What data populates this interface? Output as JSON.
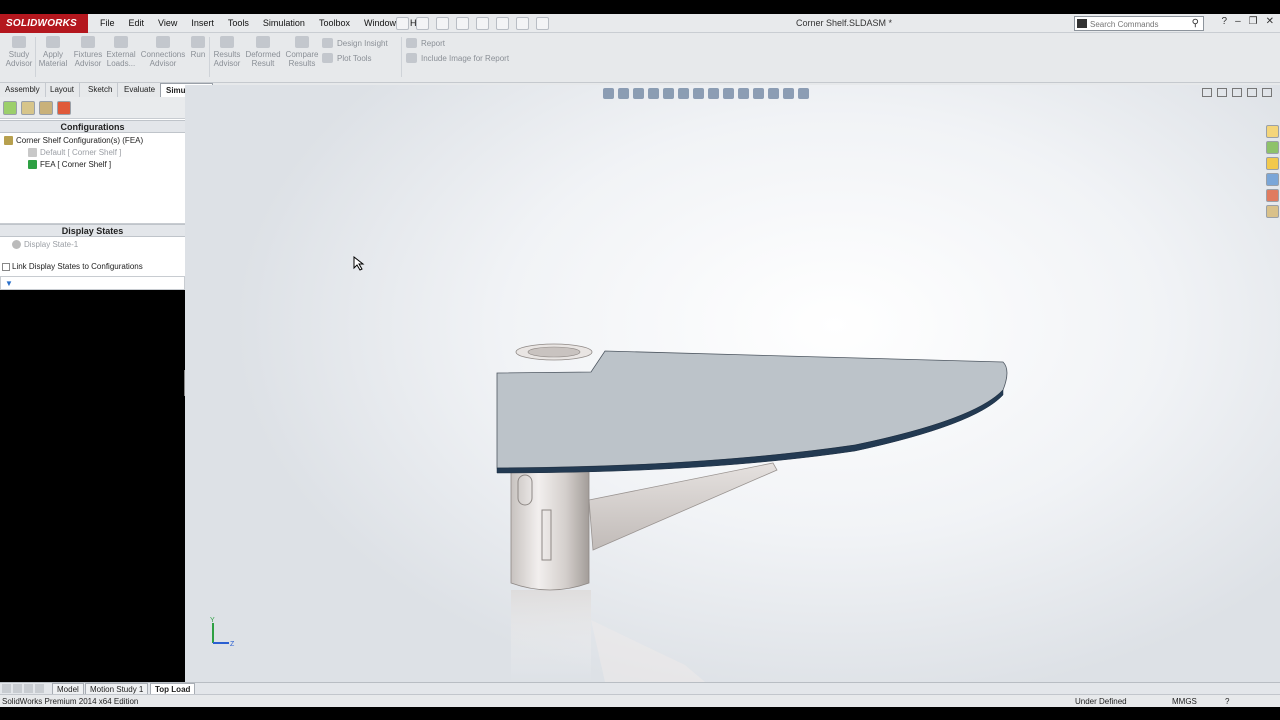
{
  "app": {
    "logo_text": "SOLIDWORKS",
    "document_title": "Corner Shelf.SLDASM *"
  },
  "menu": [
    "File",
    "Edit",
    "View",
    "Insert",
    "Tools",
    "Simulation",
    "Toolbox",
    "Window",
    "Help"
  ],
  "search": {
    "placeholder": "Search Commands"
  },
  "command_manager": {
    "study_advisor": "Study Advisor",
    "apply_material": "Apply Material",
    "fixtures_advisor": "Fixtures Advisor",
    "external_loads": "External Loads...",
    "connections_advisor": "Connections Advisor",
    "run": "Run",
    "results_advisor": "Results Advisor",
    "deformed_result": "Deformed Result",
    "compare_results": "Compare Results",
    "design_insight": "Design Insight",
    "plot_tools": "Plot Tools",
    "report": "Report",
    "include_image": "Include Image for Report"
  },
  "tabs": [
    "Assembly",
    "Layout",
    "Sketch",
    "Evaluate",
    "Simulation"
  ],
  "active_tab": "Simulation",
  "config_panel": {
    "title": "Configurations",
    "root": "Corner Shelf Configuration(s)  (FEA)",
    "items": [
      "Default [ Corner Shelf ]",
      "FEA [ Corner Shelf ]"
    ]
  },
  "display_states": {
    "title": "Display States",
    "item": "Display State-1",
    "link_checkbox": "Link Display States to Configurations"
  },
  "bottom_tabs": [
    "Model",
    "Motion Study 1",
    "Top Load"
  ],
  "active_bottom_tab": "Top Load",
  "status": {
    "edition": "SolidWorks Premium 2014 x64 Edition",
    "state": "Under Defined",
    "units": "MMGS"
  },
  "triad": {
    "y": "Y",
    "z": "Z"
  }
}
